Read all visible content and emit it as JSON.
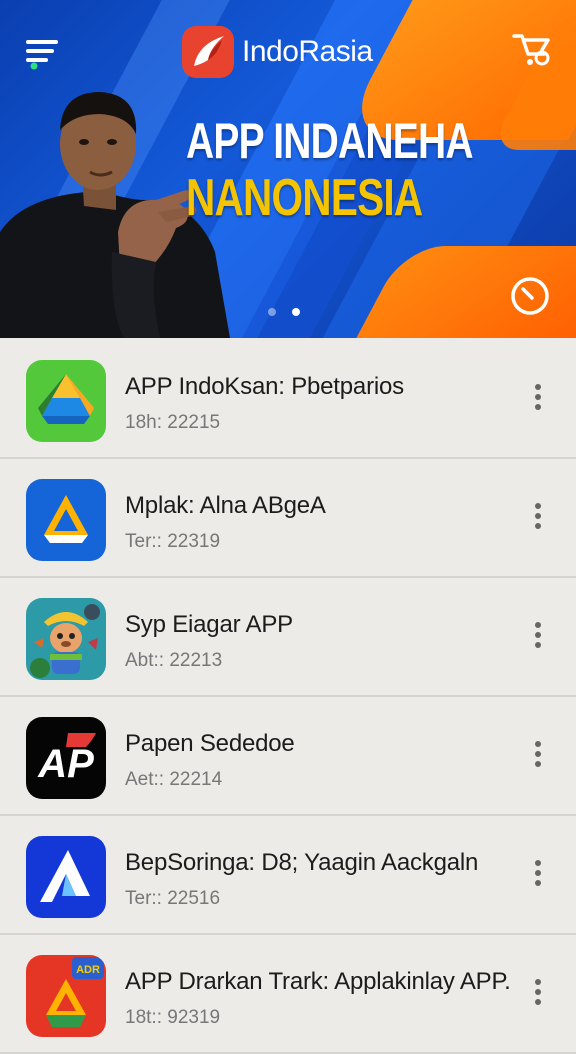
{
  "header": {
    "brand": "IndoRasia",
    "title_line1": "APP INDANEHA",
    "title_line2": "NANONESIA",
    "icons": {
      "menu": "menu-icon",
      "cart": "cart-icon",
      "timer": "timer-icon"
    },
    "carousel": {
      "count": 2,
      "active": 2
    }
  },
  "apps": [
    {
      "title": "APP IndoKsan: Pbetparios",
      "subtitle": "18h: 22215",
      "icon": "drive-green-icon"
    },
    {
      "title": "Mplak: Alna ABgeA",
      "subtitle": "Ter:: 22319",
      "icon": "drive-blue-icon"
    },
    {
      "title": "Syp Eiagar APP",
      "subtitle": "Abt:: 22213",
      "icon": "cartoon-game-icon"
    },
    {
      "title": "Papen Sededoe",
      "subtitle": "Aet:: 22214",
      "icon": "ap-logo-icon"
    },
    {
      "title": "BepSoringa: D8; Yaagin Aackgaln",
      "subtitle": "Ter:: 22516",
      "icon": "arrow-blue-icon"
    },
    {
      "title": "APP Drarkan Trark: Applakinlay APP.",
      "subtitle": "18t:: 92319",
      "icon": "drive-red-icon",
      "badge": "ADR"
    }
  ],
  "colors": {
    "hero_blue": "#0a3fb0",
    "hero_orange": "#ff7a00",
    "title_yellow": "#f5c400",
    "list_bg": "#ecebe8"
  }
}
